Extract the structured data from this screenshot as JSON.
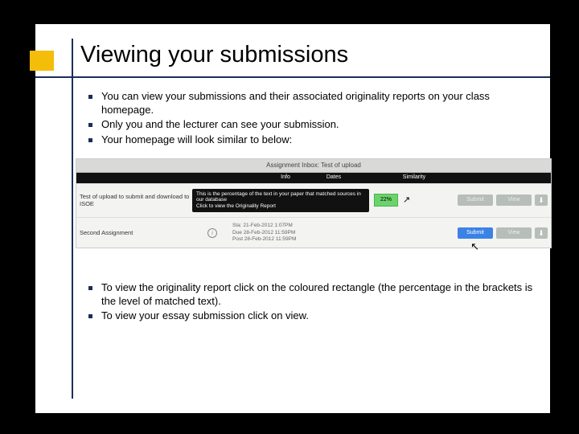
{
  "title": "Viewing your submissions",
  "bullets_top": [
    "You can view your submissions and their associated originality reports on your class homepage.",
    "Only you and the lecturer can see your submission.",
    "Your homepage will look similar to below:"
  ],
  "bullets_bottom": [
    "To view the originality report click on the coloured rectangle (the percentage in the brackets is the level of matched text).",
    "To view your essay submission click on view."
  ],
  "screenshot": {
    "banner": "Assignment Inbox: Test of upload",
    "cols": {
      "c1": "Info",
      "c2": "Dates",
      "c3": "Similarity"
    },
    "row1": {
      "name": "Test of upload to submit and download to ISOE",
      "tooltip_line1": "This is the percentage of the text in your paper that matched sources in our database",
      "tooltip_line2": "Click to view the Originality Report",
      "pct": "22%",
      "submit": "Submit",
      "view": "View"
    },
    "row2": {
      "name": "Second Assignment",
      "date1": "Sta: 21-Feb-2012 1:07PM",
      "date2": "Due 28-Feb-2012 11:59PM",
      "date3": "Post 28-Feb-2012 11:59PM",
      "submit": "Submit",
      "view": "View"
    }
  }
}
